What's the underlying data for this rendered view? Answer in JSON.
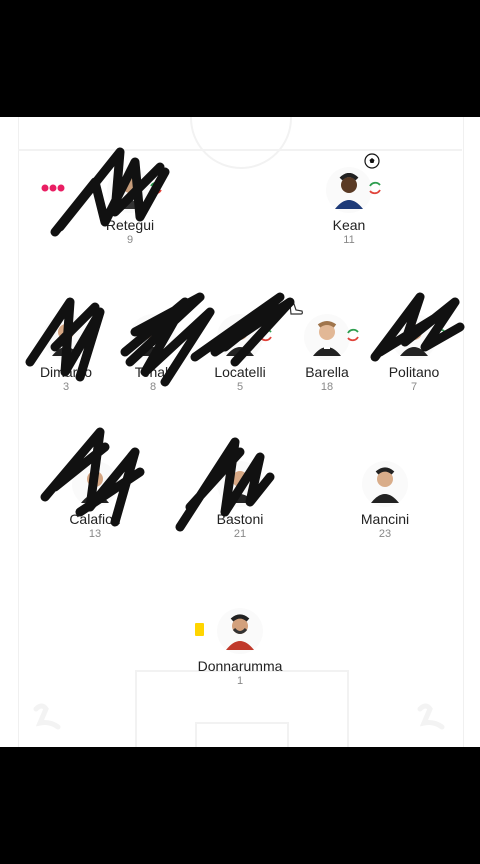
{
  "colors": {
    "page_bg": "#000000",
    "pitch_bg": "#ffffff",
    "pitch_lines": "#f2f2f2",
    "sub_green": "#2e9e4f",
    "sub_red": "#e0443b",
    "yellow_card": "#ffd500",
    "scribble": "#111111",
    "dots": "#e91e63"
  },
  "players": [
    {
      "id": "retegui",
      "name": "Retegui",
      "number": "9",
      "icons": [
        "sub-icon",
        "more-dots-icon"
      ],
      "scribbled": true
    },
    {
      "id": "kean",
      "name": "Kean",
      "number": "11",
      "icons": [
        "sub-icon",
        "goal-ball-icon"
      ]
    },
    {
      "id": "dimarco",
      "name": "Dimarco",
      "number": "3",
      "scribbled": true
    },
    {
      "id": "tonali",
      "name": "Tonali",
      "number": "8",
      "scribbled": true
    },
    {
      "id": "locatelli",
      "name": "Locatelli",
      "number": "5",
      "icons": [
        "sub-icon"
      ],
      "scribbled": true
    },
    {
      "id": "barella",
      "name": "Barella",
      "number": "18",
      "icons": [
        "sub-icon",
        "assist-boot-icon"
      ]
    },
    {
      "id": "politano",
      "name": "Politano",
      "number": "7",
      "icons": [
        "sub-icon"
      ],
      "scribbled": true
    },
    {
      "id": "calafiori",
      "name": "Calafiori",
      "number": "13",
      "scribbled": true
    },
    {
      "id": "bastoni",
      "name": "Bastoni",
      "number": "21",
      "scribbled": true
    },
    {
      "id": "mancini",
      "name": "Mancini",
      "number": "23"
    },
    {
      "id": "donnarumma",
      "name": "Donnarumma",
      "number": "1",
      "icons": [
        "yellow-card-icon"
      ]
    }
  ]
}
